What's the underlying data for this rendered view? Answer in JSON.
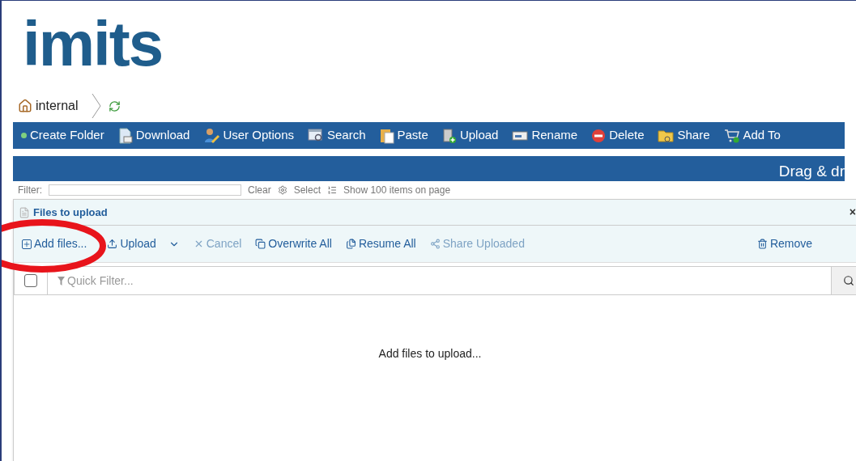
{
  "logo": {
    "text": "imits"
  },
  "breadcrumb": {
    "label": "internal"
  },
  "toolbar": [
    {
      "label": "Create Folder",
      "kind": "dot"
    },
    {
      "label": "Download",
      "kind": "download"
    },
    {
      "label": "User Options",
      "kind": "user"
    },
    {
      "label": "Search",
      "kind": "search"
    },
    {
      "label": "Paste",
      "kind": "paste"
    },
    {
      "label": "Upload",
      "kind": "upload"
    },
    {
      "label": "Rename",
      "kind": "rename"
    },
    {
      "label": "Delete",
      "kind": "delete"
    },
    {
      "label": "Share",
      "kind": "share"
    },
    {
      "label": "Add To ",
      "kind": "cart"
    }
  ],
  "banner": {
    "text": "Drag & dr"
  },
  "filter_bar": {
    "label": "Filter:",
    "clear": "Clear",
    "select": "Select",
    "show": "Show 100 items on page"
  },
  "dialog": {
    "title": "Files to upload",
    "close": "×",
    "actions": [
      {
        "label": "Add files...",
        "kind": "plus",
        "disabled": false
      },
      {
        "label": "Upload",
        "kind": "upload",
        "disabled": false,
        "caret": true
      },
      {
        "label": "Cancel",
        "kind": "x",
        "disabled": true
      },
      {
        "label": "Overwrite All",
        "kind": "copy",
        "disabled": false
      },
      {
        "label": "Resume All",
        "kind": "resume",
        "disabled": false
      },
      {
        "label": "Share Uploaded",
        "kind": "share",
        "disabled": true
      }
    ],
    "remove": {
      "label": "Remove"
    },
    "select_all": {
      "checked": false
    },
    "quick_filter": {
      "placeholder": "Quick Filter..."
    },
    "empty_message": "Add files to upload..."
  },
  "annotation": {
    "kind": "ellipse",
    "color": "#e8141b"
  }
}
